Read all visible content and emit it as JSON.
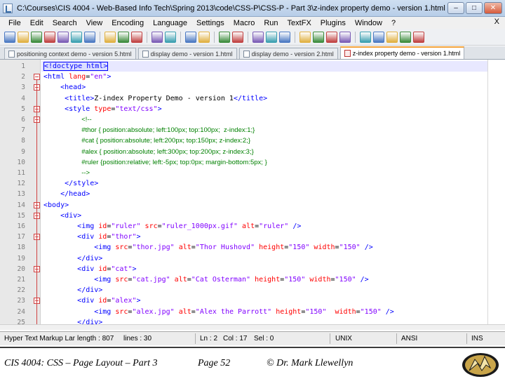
{
  "window": {
    "title": "C:\\Courses\\CIS 4004 - Web-Based Info Tech\\Spring 2013\\code\\CSS-P\\CSS-P - Part 3\\z-index property demo - version 1.html - Notepa...",
    "min_label": "–",
    "max_label": "□",
    "close_label": "✕"
  },
  "menu": {
    "items": [
      "File",
      "Edit",
      "Search",
      "View",
      "Encoding",
      "Language",
      "Settings",
      "Macro",
      "Run",
      "TextFX",
      "Plugins",
      "Window",
      "?"
    ],
    "close_doc": "X"
  },
  "toolbar": {
    "icons": [
      "new-icon",
      "open-icon",
      "save-icon",
      "save-all-icon",
      "close-icon",
      "close-all-icon",
      "print-icon",
      "cut-icon",
      "copy-icon",
      "paste-icon",
      "undo-icon",
      "redo-icon",
      "find-icon",
      "replace-icon",
      "zoom-in-icon",
      "zoom-out-icon",
      "sync-v-icon",
      "sync-h-icon",
      "wrap-icon",
      "all-chars-icon",
      "indent-guide-icon",
      "udl-icon",
      "doc-map-icon",
      "record-icon",
      "stop-icon",
      "play-icon",
      "play-multi-icon",
      "save-macro-icon"
    ]
  },
  "tabs": [
    {
      "label": "positioning context demo - version 5.html",
      "active": false
    },
    {
      "label": "display demo - version 1.html",
      "active": false
    },
    {
      "label": "display demo - version 2.html",
      "active": false
    },
    {
      "label": "z-index property demo - version 1.html",
      "active": true
    }
  ],
  "editor": {
    "lines": [
      {
        "n": "1",
        "parts": [
          [
            "tag",
            "<!doctype html>"
          ]
        ]
      },
      {
        "n": "2",
        "parts": [
          [
            "tag",
            "<html "
          ],
          [
            "attr",
            "lang"
          ],
          [
            "txt",
            "="
          ],
          [
            "val",
            "\"en\""
          ],
          [
            "tag",
            ">"
          ]
        ]
      },
      {
        "n": "3",
        "parts": [
          [
            "txt",
            "    "
          ],
          [
            "tag",
            "<head>"
          ]
        ]
      },
      {
        "n": "4",
        "parts": [
          [
            "txt",
            "     "
          ],
          [
            "tag",
            "<title>"
          ],
          [
            "txt",
            "Z-index Property Demo - version 1"
          ],
          [
            "tag",
            "</title>"
          ]
        ]
      },
      {
        "n": "5",
        "parts": [
          [
            "txt",
            "     "
          ],
          [
            "tag",
            "<style "
          ],
          [
            "attr",
            "type"
          ],
          [
            "txt",
            "="
          ],
          [
            "val",
            "\"text/css\""
          ],
          [
            "tag",
            ">"
          ]
        ]
      },
      {
        "n": "6",
        "parts": [
          [
            "txt",
            "         "
          ],
          [
            "cm",
            "<!--"
          ]
        ]
      },
      {
        "n": "7",
        "parts": [
          [
            "txt",
            "         "
          ],
          [
            "cm",
            "#thor { position:absolute; left:100px; top:100px;  z-index:1;}"
          ]
        ]
      },
      {
        "n": "8",
        "parts": [
          [
            "txt",
            "         "
          ],
          [
            "cm",
            "#cat { position:absolute; left:200px; top:150px; z-index:2;}"
          ]
        ]
      },
      {
        "n": "9",
        "parts": [
          [
            "txt",
            "         "
          ],
          [
            "cm",
            "#alex { position:absolute; left:300px; top:200px; z-index:3;}"
          ]
        ]
      },
      {
        "n": "10",
        "parts": [
          [
            "txt",
            "         "
          ],
          [
            "cm",
            "#ruler {position:relative; left:-5px; top:0px; margin-bottom:5px; }"
          ]
        ]
      },
      {
        "n": "11",
        "parts": [
          [
            "txt",
            "         "
          ],
          [
            "cm",
            "-->"
          ]
        ]
      },
      {
        "n": "12",
        "parts": [
          [
            "txt",
            "     "
          ],
          [
            "tag",
            "</style>"
          ]
        ]
      },
      {
        "n": "13",
        "parts": [
          [
            "txt",
            "    "
          ],
          [
            "tag",
            "</head>"
          ]
        ]
      },
      {
        "n": "14",
        "parts": [
          [
            "tag",
            "<body>"
          ]
        ]
      },
      {
        "n": "15",
        "parts": [
          [
            "txt",
            "    "
          ],
          [
            "tag",
            "<div>"
          ]
        ]
      },
      {
        "n": "16",
        "parts": [
          [
            "txt",
            "        "
          ],
          [
            "tag",
            "<img "
          ],
          [
            "attr",
            "id"
          ],
          [
            "txt",
            "="
          ],
          [
            "val",
            "\"ruler\""
          ],
          [
            "txt",
            " "
          ],
          [
            "attr",
            "src"
          ],
          [
            "txt",
            "="
          ],
          [
            "val",
            "\"ruler_1000px.gif\""
          ],
          [
            "txt",
            " "
          ],
          [
            "attr",
            "alt"
          ],
          [
            "txt",
            "="
          ],
          [
            "val",
            "\"ruler\""
          ],
          [
            "tag",
            " />"
          ]
        ]
      },
      {
        "n": "17",
        "parts": [
          [
            "txt",
            "        "
          ],
          [
            "tag",
            "<div "
          ],
          [
            "attr",
            "id"
          ],
          [
            "txt",
            "="
          ],
          [
            "val",
            "\"thor\""
          ],
          [
            "tag",
            ">"
          ]
        ]
      },
      {
        "n": "18",
        "parts": [
          [
            "txt",
            "            "
          ],
          [
            "tag",
            "<img "
          ],
          [
            "attr",
            "src"
          ],
          [
            "txt",
            "="
          ],
          [
            "val",
            "\"thor.jpg\""
          ],
          [
            "txt",
            " "
          ],
          [
            "attr",
            "alt"
          ],
          [
            "txt",
            "="
          ],
          [
            "val",
            "\"Thor Hushovd\""
          ],
          [
            "txt",
            " "
          ],
          [
            "attr",
            "height"
          ],
          [
            "txt",
            "="
          ],
          [
            "val",
            "\"150\""
          ],
          [
            "txt",
            " "
          ],
          [
            "attr",
            "width"
          ],
          [
            "txt",
            "="
          ],
          [
            "val",
            "\"150\""
          ],
          [
            "tag",
            " />"
          ]
        ]
      },
      {
        "n": "19",
        "parts": [
          [
            "txt",
            "        "
          ],
          [
            "tag",
            "</div>"
          ]
        ]
      },
      {
        "n": "20",
        "parts": [
          [
            "txt",
            "        "
          ],
          [
            "tag",
            "<div "
          ],
          [
            "attr",
            "id"
          ],
          [
            "txt",
            "="
          ],
          [
            "val",
            "\"cat\""
          ],
          [
            "tag",
            ">"
          ]
        ]
      },
      {
        "n": "21",
        "parts": [
          [
            "txt",
            "            "
          ],
          [
            "tag",
            "<img "
          ],
          [
            "attr",
            "src"
          ],
          [
            "txt",
            "="
          ],
          [
            "val",
            "\"cat.jpg\""
          ],
          [
            "txt",
            " "
          ],
          [
            "attr",
            "alt"
          ],
          [
            "txt",
            "="
          ],
          [
            "val",
            "\"Cat Osterman\""
          ],
          [
            "txt",
            " "
          ],
          [
            "attr",
            "height"
          ],
          [
            "txt",
            "="
          ],
          [
            "val",
            "\"150\""
          ],
          [
            "txt",
            " "
          ],
          [
            "attr",
            "width"
          ],
          [
            "txt",
            "="
          ],
          [
            "val",
            "\"150\""
          ],
          [
            "tag",
            " />"
          ]
        ]
      },
      {
        "n": "22",
        "parts": [
          [
            "txt",
            "        "
          ],
          [
            "tag",
            "</div>"
          ]
        ]
      },
      {
        "n": "23",
        "parts": [
          [
            "txt",
            "        "
          ],
          [
            "tag",
            "<div "
          ],
          [
            "attr",
            "id"
          ],
          [
            "txt",
            "="
          ],
          [
            "val",
            "\"alex\""
          ],
          [
            "tag",
            ">"
          ]
        ]
      },
      {
        "n": "24",
        "parts": [
          [
            "txt",
            "            "
          ],
          [
            "tag",
            "<img "
          ],
          [
            "attr",
            "src"
          ],
          [
            "txt",
            "="
          ],
          [
            "val",
            "\"alex.jpg\""
          ],
          [
            "txt",
            " "
          ],
          [
            "attr",
            "alt"
          ],
          [
            "txt",
            "="
          ],
          [
            "val",
            "\"Alex the Parrott\""
          ],
          [
            "txt",
            " "
          ],
          [
            "attr",
            "height"
          ],
          [
            "txt",
            "="
          ],
          [
            "val",
            "\"150\""
          ],
          [
            "txt",
            "  "
          ],
          [
            "attr",
            "width"
          ],
          [
            "txt",
            "="
          ],
          [
            "val",
            "\"150\""
          ],
          [
            "tag",
            " />"
          ]
        ]
      },
      {
        "n": "25",
        "parts": [
          [
            "txt",
            "        "
          ],
          [
            "tag",
            "</div>"
          ]
        ]
      }
    ]
  },
  "status": {
    "lang": "Hyper Text Markup Lar",
    "length": "length : 807",
    "lines": "lines : 30",
    "ln": "Ln : 2",
    "col": "Col : 17",
    "sel": "Sel : 0",
    "eol": "UNIX",
    "enc": "ANSI",
    "mode": "INS"
  },
  "footer": {
    "left": "CIS 4004: CSS – Page Layout – Part 3",
    "center": "Page 52",
    "right": "© Dr. Mark Llewellyn"
  },
  "colors": {
    "tag": "#0000ff",
    "attr": "#ff0000",
    "value": "#8000ff",
    "comment": "#008000",
    "current_line": "#e8e8ff"
  }
}
